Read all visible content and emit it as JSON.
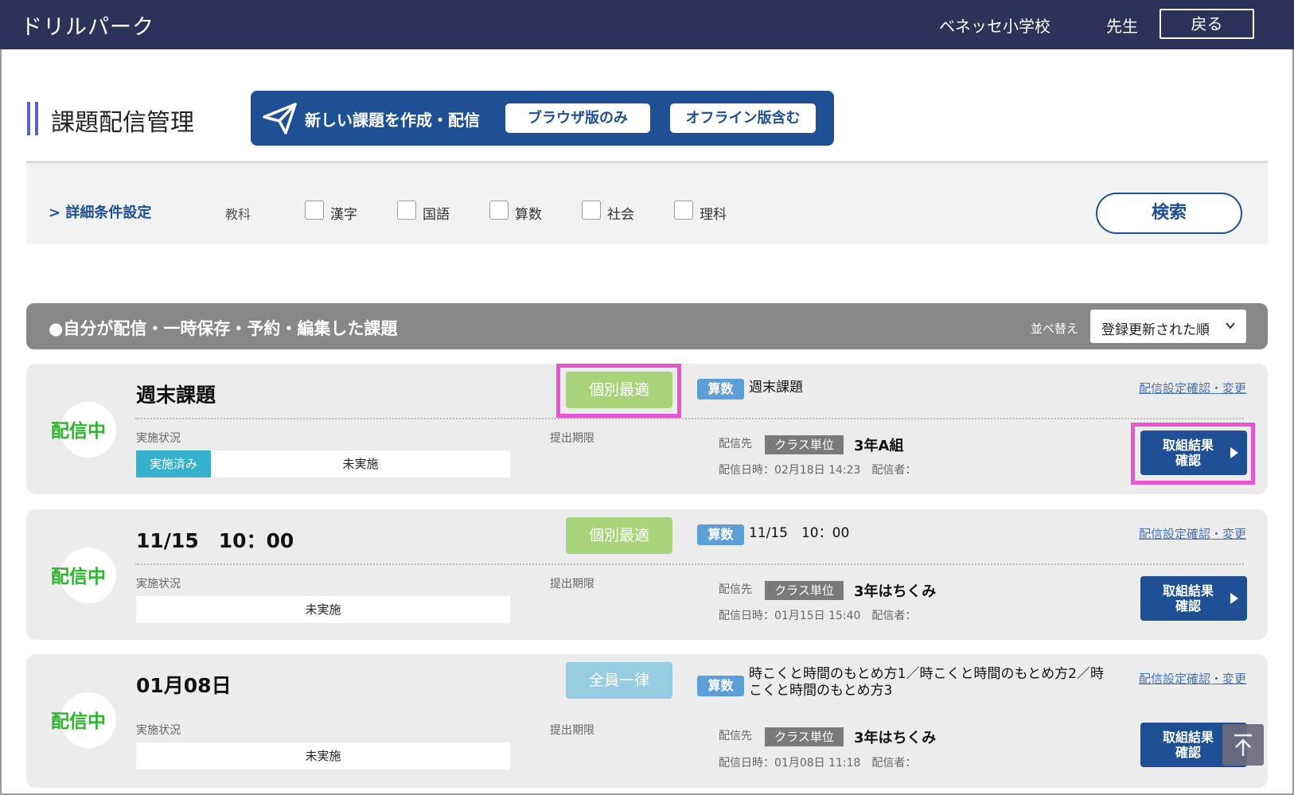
{
  "header": {
    "brand": "ドリルパーク",
    "school": "ベネッセ小学校",
    "user": "先生",
    "back_label": "戻る"
  },
  "page": {
    "title": "課題配信管理",
    "create": {
      "label": "新しい課題を作成・配信",
      "browser_only": "ブラウザ版のみ",
      "with_offline": "オフライン版含む",
      "icon": "paper-plane-icon"
    }
  },
  "filter": {
    "toggle_label": "詳細条件設定",
    "subject_label": "教科",
    "subjects": [
      "漢字",
      "国語",
      "算数",
      "社会",
      "理科"
    ],
    "search_label": "検索"
  },
  "section": {
    "title": "●自分が配信・一時保存・予約・編集した課題",
    "sort_label": "並べ替え",
    "sort_value": "登録更新された順"
  },
  "labels": {
    "progress": "実施状況",
    "deadline": "提出期限",
    "destination": "配信先",
    "config_link": "配信設定確認・変更",
    "result_line1": "取組結果",
    "result_line2": "確認"
  },
  "tasks": [
    {
      "status": "配信中",
      "title": "週末課題",
      "mode": "個別最適",
      "subject": "算数",
      "task_name": "週末課題",
      "done_label": "実施済み",
      "not_done_label": "未実施",
      "done_fraction": 0.2,
      "unit": "クラス単位",
      "class": "3年A組",
      "sent_info": "配信日時：02月18日 14:23　配信者："
    },
    {
      "status": "配信中",
      "title": "11/15　10：00",
      "mode": "個別最適",
      "subject": "算数",
      "task_name": "11/15　10：00",
      "not_done_label": "未実施",
      "done_fraction": 0,
      "unit": "クラス単位",
      "class": "3年はちくみ",
      "sent_info": "配信日時：01月15日 15:40　配信者："
    },
    {
      "status": "配信中",
      "title": "01月08日",
      "mode": "全員一律",
      "subject": "算数",
      "task_name_line1": "時こくと時間のもとめ方1／時こくと時間のもとめ方2／時",
      "task_name_line2": "こくと時間のもとめ方3",
      "not_done_label": "未実施",
      "done_fraction": 0,
      "unit": "クラス単位",
      "class": "3年はちくみ",
      "sent_info": "配信日時：01月08日 11:18　配信者："
    }
  ],
  "colors": {
    "header_bg": "#2c3258",
    "primary": "#1f4f94",
    "status_green": "#2db52d",
    "highlight": "#e855d0"
  },
  "scroll_top_icon": "arrow-up-icon"
}
